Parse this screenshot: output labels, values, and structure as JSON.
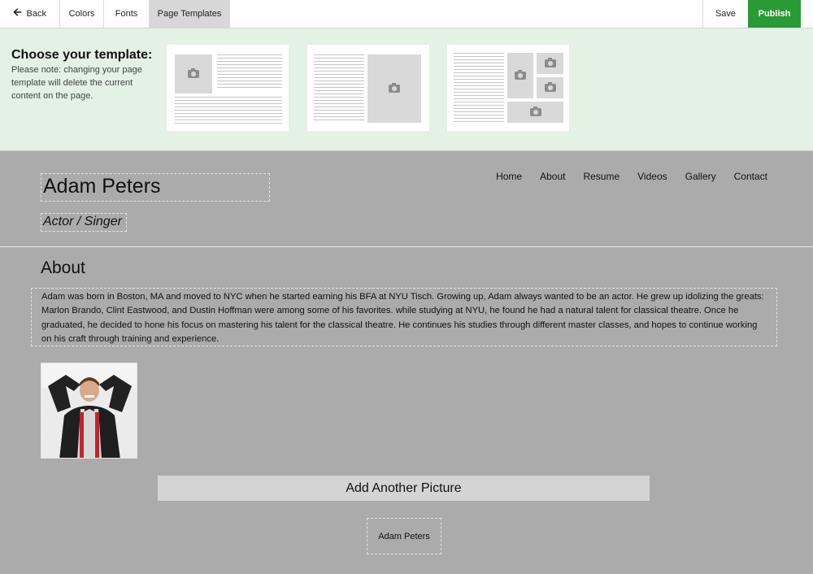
{
  "toolbar": {
    "back_label": "Back",
    "colors_label": "Colors",
    "fonts_label": "Fonts",
    "templates_label": "Page Templates",
    "save_label": "Save",
    "publish_label": "Publish",
    "publish_color": "#2a9a37"
  },
  "chooser": {
    "title": "Choose your template:",
    "note": "Please note: changing your page template will delete the current content on the page.",
    "background": "#e3f2e3"
  },
  "site": {
    "name": "Adam Peters",
    "tagline": "Actor / Singer",
    "nav": [
      "Home",
      "About",
      "Resume",
      "Videos",
      "Gallery",
      "Contact"
    ],
    "about_title": "About",
    "about_text": "Adam was born in Boston, MA and moved to NYC when he started earning his BFA at NYU Tisch. Growing up, Adam always wanted to be an actor. He grew up idolizing the greats: Marlon Brando, Clint Eastwood, and Dustin Hoffman were among some of his favorites. while studying at NYU, he found he had a natural talent for classical theatre. Once he graduated, he decided to hone his focus on mastering his talent for the classical theatre. He continues his studies through different master classes, and hopes to continue working on his craft through training and experience.",
    "add_picture_label": "Add Another Picture",
    "footer_name": "Adam Peters"
  }
}
